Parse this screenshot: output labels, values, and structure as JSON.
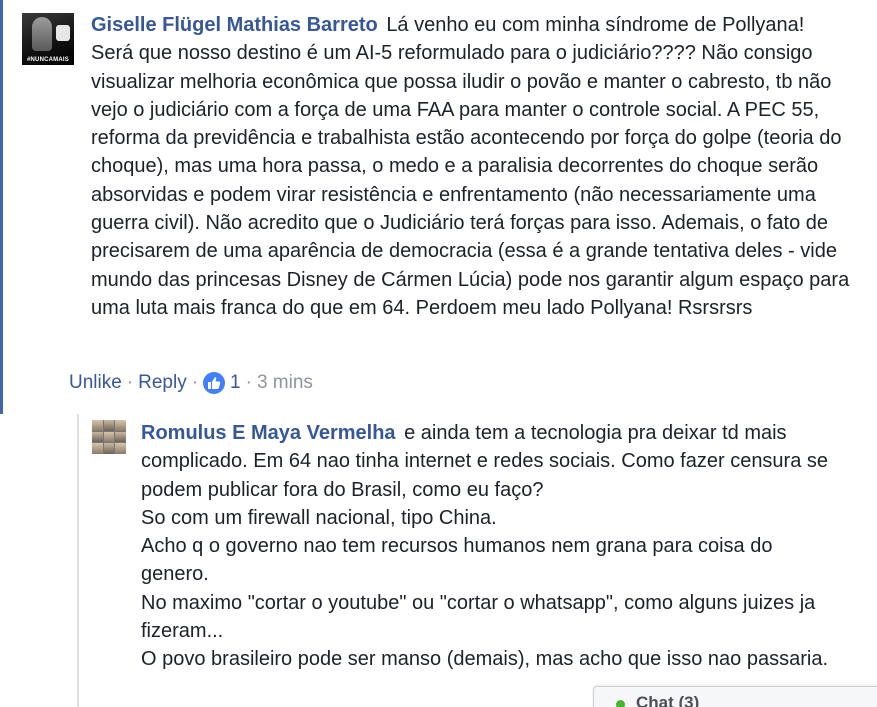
{
  "comment": {
    "author": "Giselle Flügel Mathias Barreto",
    "avatar_tag": "#NUNCAMAIS",
    "text": "Lá venho eu com minha síndrome de Pollyana! Será que nosso destino é um AI-5 reformulado para o judiciário???? Não consigo visualizar melhoria econômica que possa iludir o povão e manter o cabresto, tb não vejo o judiciário com a força de uma FAA para manter o controle social. A PEC 55, reforma da previdência e trabalhista estão acontecendo por força do golpe (teoria do choque), mas uma hora passa, o medo e a paralisia decorrentes do choque serão absorvidas e podem virar resistência e enfrentamento (não necessariamente uma guerra civil). Não acredito que o Judiciário terá forças para isso. Ademais, o fato de precisarem de uma aparência de democracia (essa é a grande tentativa deles - vide mundo das princesas Disney de Cármen Lúcia) pode nos garantir algum espaço para uma luta mais franca do que em 64. Perdoem meu lado Pollyana! Rsrsrsrs",
    "actions": {
      "unlike": "Unlike",
      "reply": "Reply",
      "like_count": "1",
      "time": "3 mins",
      "separator": "·"
    }
  },
  "reply": {
    "author": "Romulus E Maya Vermelha",
    "lines": [
      "e ainda tem a tecnologia pra deixar td mais complicado. Em 64 nao tinha internet e redes sociais. Como fazer censura se podem publicar fora do Brasil, como eu faço?",
      "So com um firewall nacional, tipo China.",
      "Acho q o governo nao tem recursos humanos nem grana para coisa do genero.",
      "No maximo \"cortar o youtube\" ou \"cortar o whatsapp\", como alguns juizes ja fizeram...",
      "O povo brasileiro pode ser manso (demais), mas acho que isso nao passaria."
    ]
  },
  "chat": {
    "label": "Chat (3)",
    "status_color": "#42b72a"
  },
  "colors": {
    "link": "#365899",
    "meta": "#90949c",
    "like_badge": "#4080ff",
    "highlight_bar": "#4267b2"
  }
}
